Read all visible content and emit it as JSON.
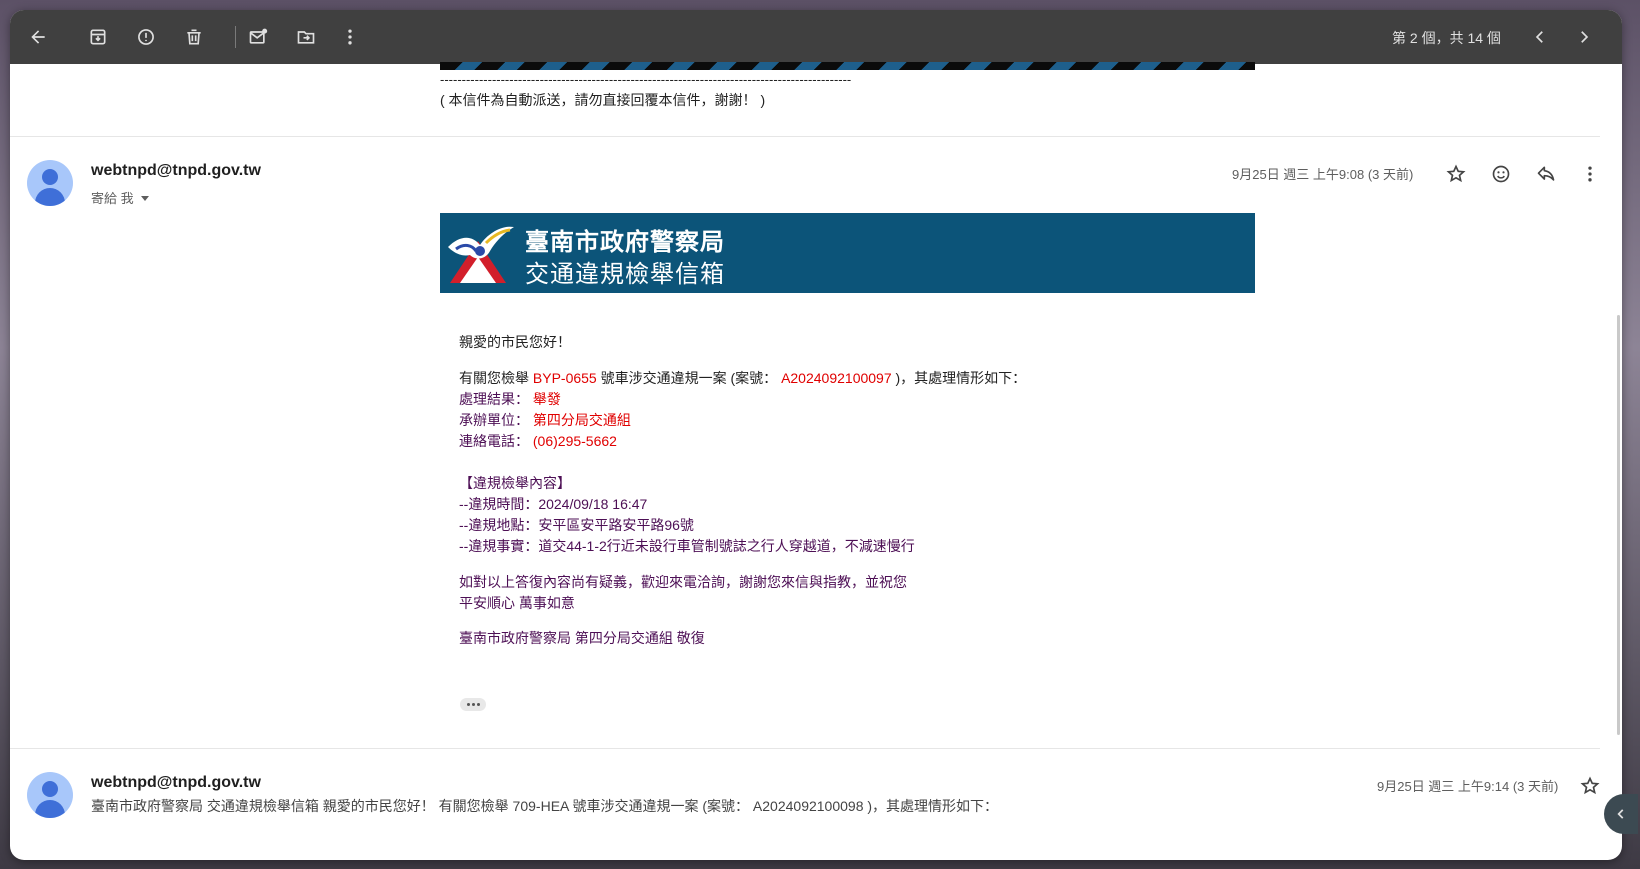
{
  "toolbar": {
    "pager_text": "第 2 個，共 14 個",
    "icons": [
      "back-arrow-icon",
      "archive-icon",
      "report-spam-icon",
      "delete-icon",
      "mark-unread-icon",
      "move-to-icon",
      "more-vert-icon",
      "chevron-left-icon",
      "chevron-right-icon"
    ]
  },
  "previous_message": {
    "dashes": "-----------------------------------------------------------------------------------------------",
    "auto_note": "( 本信件為自動派送，請勿直接回覆本信件，謝謝！ )"
  },
  "message": {
    "sender": "webtnpd@tnpd.gov.tw",
    "to_me": "寄給 我",
    "date": "9月25日 週三 上午9:08 (3 天前)",
    "banner": {
      "title1": "臺南市政府警察局",
      "title2": "交通違規檢舉信箱",
      "colors": {
        "background": "#0c5479"
      }
    },
    "greeting": "親愛的市民您好！",
    "case_line": {
      "prefix": "有關您檢舉 ",
      "plate": "BYP-0655",
      "middle": " 號車涉交通違規一案 (案號： ",
      "case_no": "A2024092100097",
      "suffix": " )，其處理情形如下："
    },
    "result_label": "處理結果：",
    "result_value": "舉發",
    "unit_label": "承辦單位：",
    "unit_value": "第四分局交通組",
    "phone_label": "連絡電話：",
    "phone_value": "(06)295-5662",
    "content_header": "【違規檢舉內容】",
    "violation_time": "--違規時間：2024/09/18 16:47",
    "violation_place": "--違規地點：安平區安平路安平路96號",
    "violation_fact": "--違規事實：道交44-1-2行近未設行車管制號誌之行人穿越道，不減速慢行",
    "closing1": "如對以上答復內容尚有疑義，歡迎來電洽詢，謝謝您來信與指教，並祝您",
    "closing2": "平安順心 萬事如意",
    "signature": "臺南市政府警察局 第四分局交通組 敬復"
  },
  "next_message": {
    "sender": "webtnpd@tnpd.gov.tw",
    "date": "9月25日 週三 上午9:14 (3 天前)",
    "snippet": "臺南市政府警察局 交通違規檢舉信箱 親愛的市民您好！ 有關您檢舉 709-HEA 號車涉交通違規一案 (案號： A2024092100098 )，其處理情形如下："
  },
  "colors": {
    "toolbar": "#404040",
    "accent_red": "#e00000",
    "body_purple": "#4d0f55"
  }
}
